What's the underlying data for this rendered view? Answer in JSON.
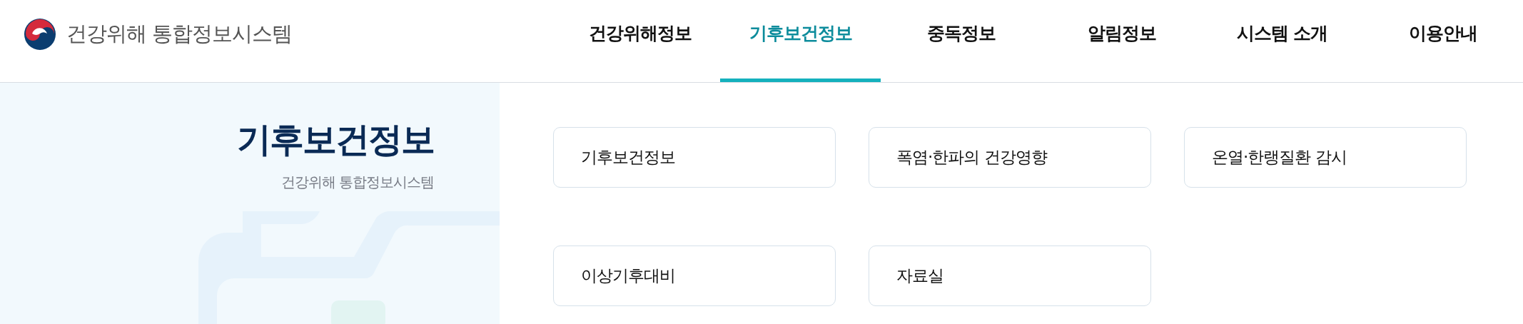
{
  "header": {
    "logo_text": "건강위해 통합정보시스템",
    "nav": [
      {
        "label": "건강위해정보",
        "selected": false
      },
      {
        "label": "기후보건정보",
        "selected": true
      },
      {
        "label": "중독정보",
        "selected": false
      },
      {
        "label": "알림정보",
        "selected": false
      },
      {
        "label": "시스템 소개",
        "selected": false
      },
      {
        "label": "이용안내",
        "selected": false
      }
    ]
  },
  "side_panel": {
    "title": "기후보건정보",
    "subtitle": "건강위해 통합정보시스템"
  },
  "menu_cards": [
    {
      "label": "기후보건정보"
    },
    {
      "label": "폭염·한파의 건강영향"
    },
    {
      "label": "온열·한랭질환 감시"
    },
    {
      "label": "이상기후대비"
    },
    {
      "label": "자료실"
    }
  ]
}
